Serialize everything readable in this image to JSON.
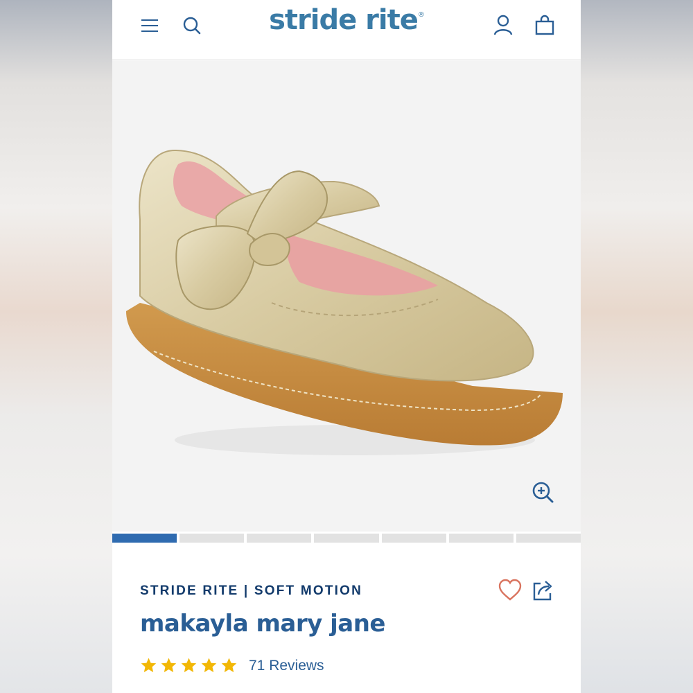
{
  "header": {
    "logo_text": "stride rite",
    "logo_mark": "®",
    "icons": [
      "hamburger-menu-icon",
      "search-icon",
      "account-icon",
      "shopping-bag-icon"
    ]
  },
  "gallery": {
    "image_alt": "gold metallic mary jane baby shoe with bow",
    "slide_count": 7,
    "active_slide": 1,
    "zoom_icon": "zoom-in-icon"
  },
  "product": {
    "brand_line": "STRIDE RITE | SOFT MOTION",
    "title": "makayla mary jane",
    "rating_stars": 5,
    "reviews_label": "71 Reviews",
    "favorite_icon": "heart-icon",
    "share_icon": "share-icon"
  },
  "colors": {
    "brand_blue": "#3a7ba6",
    "title_blue": "#2a5e95",
    "navy": "#123a6b",
    "star_gold": "#f2b705",
    "heart_coral": "#d9735e",
    "progress_active": "#2f6bb0"
  }
}
